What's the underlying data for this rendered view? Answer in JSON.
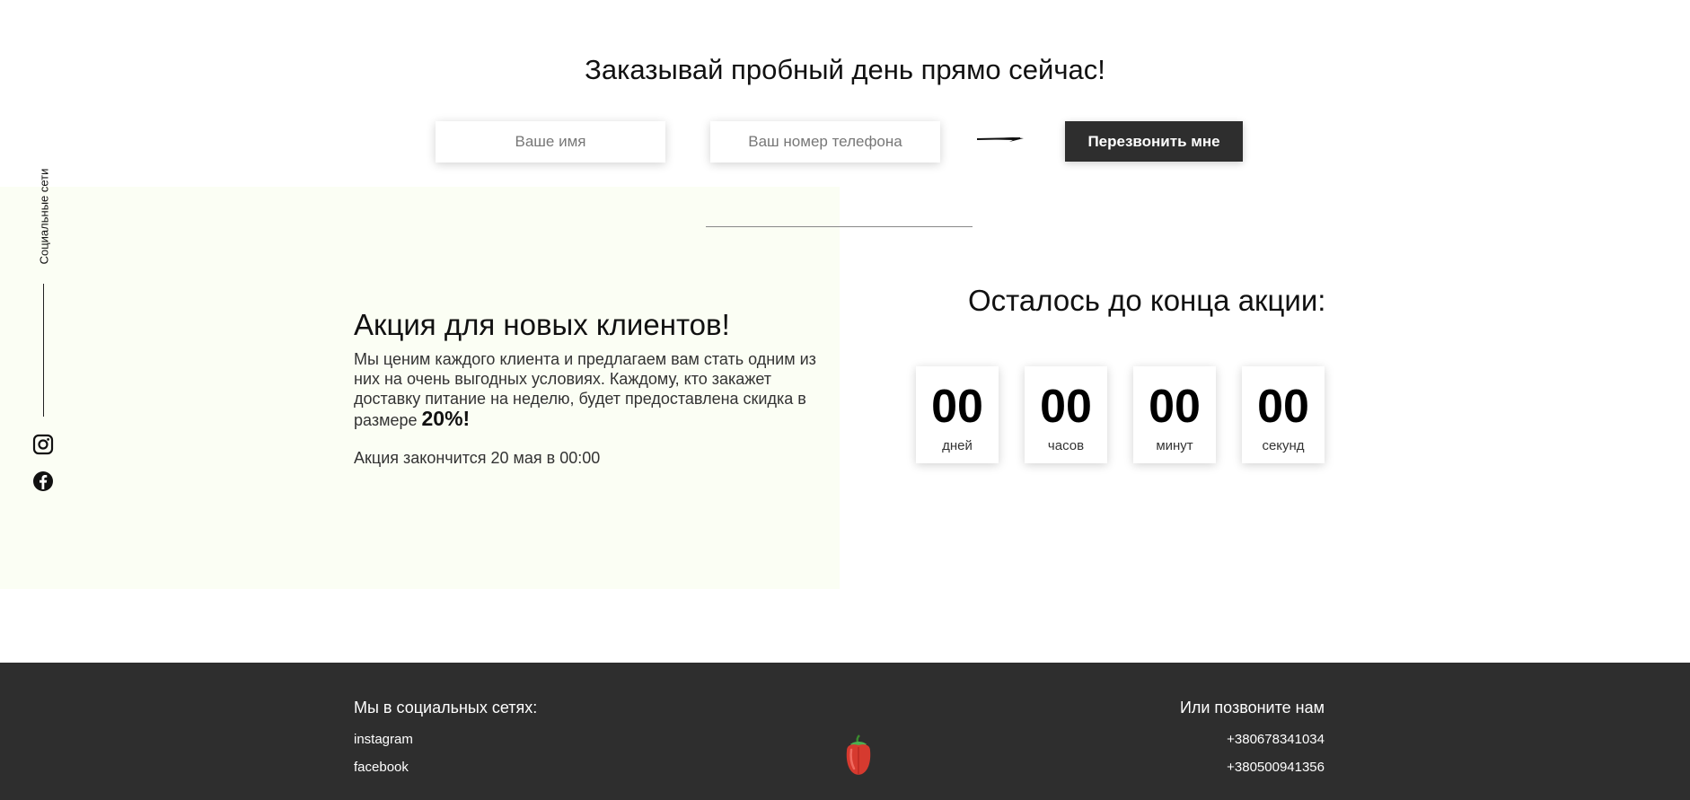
{
  "trial": {
    "title": "Заказывай пробный день прямо сейчас!",
    "name_placeholder": "Ваше имя",
    "phone_placeholder": "Ваш номер телефона",
    "button_label": "Перезвонить мне"
  },
  "sidebar": {
    "label": "Социальные сети",
    "icons": [
      "instagram-icon",
      "facebook-icon"
    ]
  },
  "promo": {
    "title": "Акция для новых клиентов!",
    "text": "Мы ценим каждого клиента и предлагаем вам стать одним из них на очень выгодных условиях. Каждому, кто закажет доставку питание на неделю, будет предоставлена скидка в размере",
    "discount": "20%!",
    "end_text": "Акция закончится 20 мая в 00:00",
    "panel_color": "#fbfef4"
  },
  "countdown": {
    "title": "Осталось до конца акции:",
    "units": [
      {
        "value": "00",
        "label": "дней"
      },
      {
        "value": "00",
        "label": "часов"
      },
      {
        "value": "00",
        "label": "минут"
      },
      {
        "value": "00",
        "label": "секунд"
      }
    ]
  },
  "footer": {
    "social_heading": "Мы в социальных сетях:",
    "social_links": [
      "instagram",
      "facebook"
    ],
    "call_heading": "Или позвоните нам",
    "phones": [
      "+380678341034",
      "+380500941356"
    ],
    "logo_icon": "pepper-icon",
    "background": "#2e2e2e"
  }
}
